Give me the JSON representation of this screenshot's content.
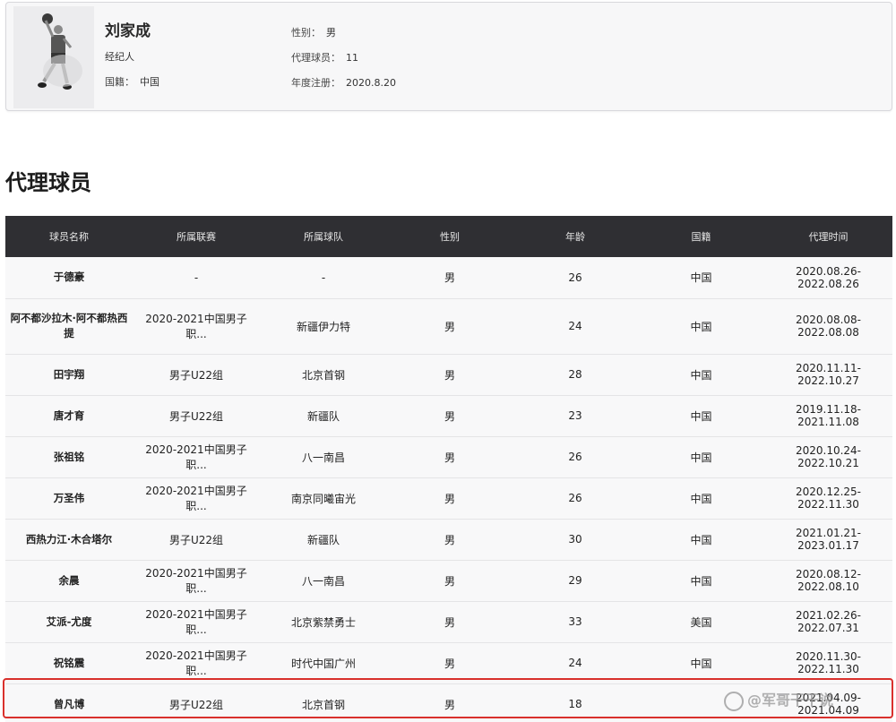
{
  "profile": {
    "name": "刘家成",
    "role": "经纪人",
    "nationality_label": "国籍：",
    "nationality": "中国",
    "gender_label": "性别：",
    "gender": "男",
    "player_count_label": "代理球员：",
    "player_count": "11",
    "registration_label": "年度注册：",
    "registration": "2020.8.20"
  },
  "section_title": "代理球员",
  "table": {
    "headers": [
      "球员名称",
      "所属联赛",
      "所属球队",
      "性别",
      "年龄",
      "国籍",
      "代理时间"
    ],
    "rows": [
      [
        "于德豪",
        "-",
        "-",
        "男",
        "26",
        "中国",
        "2020.08.26-2022.08.26"
      ],
      [
        "阿不都沙拉木·阿不都热西提",
        "2020-2021中国男子职...",
        "新疆伊力特",
        "男",
        "24",
        "中国",
        "2020.08.08-2022.08.08"
      ],
      [
        "田宇翔",
        "男子U22组",
        "北京首钢",
        "男",
        "28",
        "中国",
        "2020.11.11-2022.10.27"
      ],
      [
        "唐才育",
        "男子U22组",
        "新疆队",
        "男",
        "23",
        "中国",
        "2019.11.18-2021.11.08"
      ],
      [
        "张祖铭",
        "2020-2021中国男子职...",
        "八一南昌",
        "男",
        "26",
        "中国",
        "2020.10.24-2022.10.21"
      ],
      [
        "万圣伟",
        "2020-2021中国男子职...",
        "南京同曦宙光",
        "男",
        "26",
        "中国",
        "2020.12.25-2022.11.30"
      ],
      [
        "西热力江·木合塔尔",
        "男子U22组",
        "新疆队",
        "男",
        "30",
        "中国",
        "2021.01.21-2023.01.17"
      ],
      [
        "余晨",
        "2020-2021中国男子职...",
        "八一南昌",
        "男",
        "29",
        "中国",
        "2020.08.12-2022.08.10"
      ],
      [
        "艾派-尤度",
        "2020-2021中国男子职...",
        "北京紫禁勇士",
        "男",
        "33",
        "美国",
        "2021.02.26-2022.07.31"
      ],
      [
        "祝铭震",
        "2020-2021中国男子职...",
        "时代中国广州",
        "男",
        "24",
        "中国",
        "2020.11.30-2022.11.30"
      ],
      [
        "曾凡博",
        "男子U22组",
        "北京首钢",
        "男",
        "18",
        "",
        "2021.04.09-2021.04.09"
      ]
    ]
  },
  "watermark": "@军哥干干说"
}
